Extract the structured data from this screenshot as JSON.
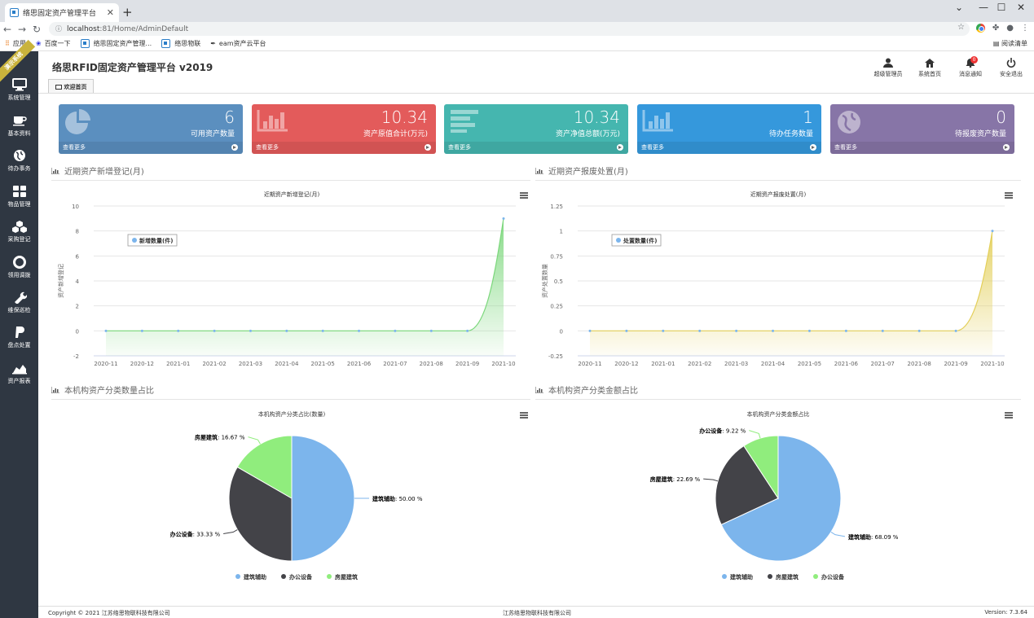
{
  "browser": {
    "tab_title": "络思固定资产管理平台",
    "url_host": "localhost",
    "url_rest": ":81/Home/AdminDefault",
    "bookmarks": [
      "应用",
      "百度一下",
      "络思固定资产管理...",
      "络思物联",
      "eam资产云平台"
    ],
    "reading_list": "阅读清单"
  },
  "sidebar": {
    "ribbon": "演示系统",
    "items": [
      {
        "label": "系统管理",
        "icon": "monitor-icon"
      },
      {
        "label": "基本资料",
        "icon": "coffee-icon"
      },
      {
        "label": "待办事务",
        "icon": "globe-icon"
      },
      {
        "label": "物品管理",
        "icon": "grid-icon"
      },
      {
        "label": "采购登记",
        "icon": "cubes-icon"
      },
      {
        "label": "领用调拨",
        "icon": "lifebuoy-icon"
      },
      {
        "label": "维保巡检",
        "icon": "wrench-icon"
      },
      {
        "label": "盘点处置",
        "icon": "paypal-icon"
      },
      {
        "label": "资产报表",
        "icon": "area-chart-icon"
      }
    ]
  },
  "header": {
    "title": "络思RFID固定资产管理平台 v2019",
    "tab": "欢迎首页",
    "actions": {
      "user": "超级管理员",
      "home": "系统首页",
      "notify": "消息通知",
      "notify_badge": "0",
      "logout": "安全退出"
    }
  },
  "cards": [
    {
      "value": "6",
      "label": "可用资产数量",
      "more": "查看更多",
      "color": "#5b8fbf",
      "icon": "pie-chart-icon"
    },
    {
      "value": "10.34",
      "label": "资产原值合计(万元)",
      "more": "查看更多",
      "color": "#e35b5b",
      "icon": "bar-chart-icon"
    },
    {
      "value": "10.34",
      "label": "资产净值总额(万元)",
      "more": "查看更多",
      "color": "#45b6af",
      "icon": "align-left-icon"
    },
    {
      "value": "1",
      "label": "待办任务数量",
      "more": "查看更多",
      "color": "#3598dc",
      "icon": "bar-chart-icon"
    },
    {
      "value": "0",
      "label": "待报废资产数量",
      "more": "查看更多",
      "color": "#8775a7",
      "icon": "globe-icon"
    }
  ],
  "sections": {
    "new_assets": "近期资产新增登记(月)",
    "disposal": "近期资产报废处置(月)",
    "count_ratio": "本机构资产分类数量占比",
    "amount_ratio": "本机构资产分类金额占比"
  },
  "chart_data": [
    {
      "type": "area",
      "title": "近期资产新增登记(月)",
      "ylabel": "资产新增登记",
      "legend_position": "top-left",
      "series": [
        {
          "name": "新增数量(件)",
          "values": [
            0,
            0,
            0,
            0,
            0,
            0,
            0,
            0,
            0,
            0,
            0,
            9
          ]
        }
      ],
      "x": [
        "2020-11",
        "2020-12",
        "2021-01",
        "2021-02",
        "2021-03",
        "2021-04",
        "2021-05",
        "2021-06",
        "2021-07",
        "2021-08",
        "2021-09",
        "2021-10"
      ],
      "ylim": [
        -2,
        10
      ],
      "yticks": [
        "-2",
        "0",
        "2",
        "4",
        "6",
        "8",
        "10"
      ],
      "color": "#7bd77b"
    },
    {
      "type": "area",
      "title": "近期资产报废处置(月)",
      "ylabel": "资产处置数量",
      "legend_position": "top-left",
      "series": [
        {
          "name": "处置数量(件)",
          "values": [
            0,
            0,
            0,
            0,
            0,
            0,
            0,
            0,
            0,
            0,
            0,
            1
          ]
        }
      ],
      "x": [
        "2020-11",
        "2020-12",
        "2021-01",
        "2021-02",
        "2021-03",
        "2021-04",
        "2021-05",
        "2021-06",
        "2021-07",
        "2021-08",
        "2021-09",
        "2021-10"
      ],
      "ylim": [
        -0.25,
        1.25
      ],
      "yticks": [
        "-0.25",
        "0",
        "0.25",
        "0.5",
        "0.75",
        "1",
        "1.25"
      ],
      "color": "#e3cf59"
    },
    {
      "type": "pie",
      "title": "本机构资产分类占比(数量)",
      "legend_position": "bottom",
      "slices": [
        {
          "name": "建筑辅助",
          "value": 50.0,
          "label": "50.00 %",
          "color": "#7cb5ec"
        },
        {
          "name": "办公设备",
          "value": 33.33,
          "label": "33.33 %",
          "color": "#434348"
        },
        {
          "name": "房屋建筑",
          "value": 16.67,
          "label": "16.67 %",
          "color": "#90ed7d"
        }
      ]
    },
    {
      "type": "pie",
      "title": "本机构资产分类金额占比",
      "legend_position": "bottom",
      "slices": [
        {
          "name": "建筑辅助",
          "value": 68.09,
          "label": "68.09 %",
          "color": "#7cb5ec"
        },
        {
          "name": "房屋建筑",
          "value": 22.69,
          "label": "22.69 %",
          "color": "#434348"
        },
        {
          "name": "办公设备",
          "value": 9.22,
          "label": "9.22 %",
          "color": "#90ed7d"
        }
      ]
    }
  ],
  "footer": {
    "copyright": "Copyright © 2021 江苏络思物联科技有限公司",
    "company": "江苏络思物联科技有限公司",
    "version": "Version: 7.3.64"
  }
}
